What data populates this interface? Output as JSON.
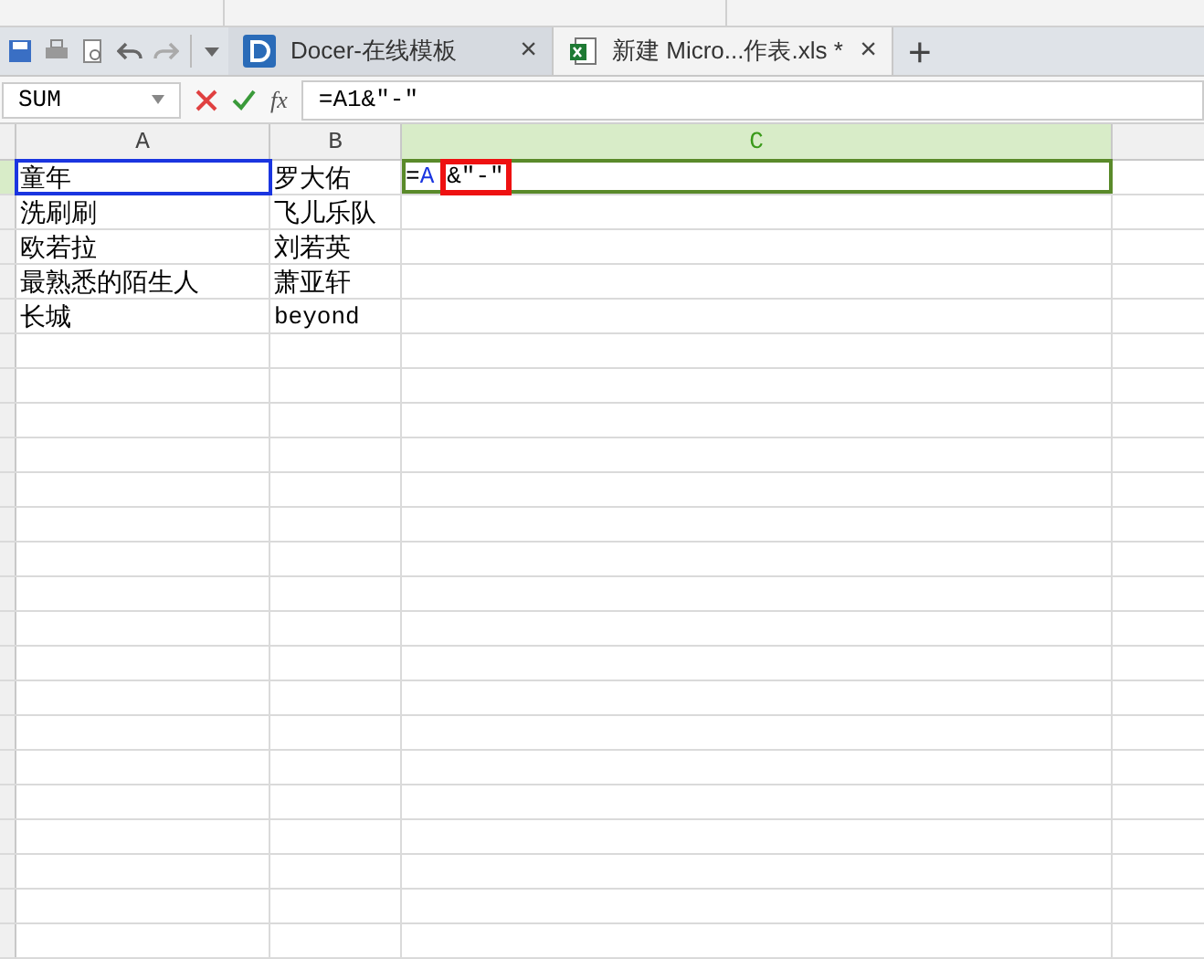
{
  "toolbar": {
    "tabs": [
      {
        "label": "Docer-在线模板",
        "kind": "docer",
        "selected": false,
        "close": "×"
      },
      {
        "label": "新建 Micro...作表.xls *",
        "kind": "excel",
        "selected": true,
        "close": "×"
      }
    ],
    "new_tab": "+"
  },
  "formula_bar": {
    "name_box": "SUM",
    "function_button": "fx",
    "formula": "=A1&″-″"
  },
  "columns": [
    {
      "label": "A",
      "selected": false
    },
    {
      "label": "B",
      "selected": false
    },
    {
      "label": "C",
      "selected": true
    }
  ],
  "rows": [
    {
      "a": "童年",
      "b": "罗大佑",
      "a_selected": true,
      "editing": true
    },
    {
      "a": "洗刷刷",
      "b": "飞儿乐队",
      "a_selected": false,
      "editing": false
    },
    {
      "a": "欧若拉",
      "b": "刘若英",
      "a_selected": false,
      "editing": false
    },
    {
      "a": "最熟悉的陌生人",
      "b": "萧亚轩",
      "a_selected": false,
      "editing": false
    },
    {
      "a": "长城",
      "b": "beyond",
      "a_selected": false,
      "editing": false
    }
  ],
  "edit_cell": {
    "equals": "=",
    "reference": "A",
    "rest": "&″-″"
  }
}
